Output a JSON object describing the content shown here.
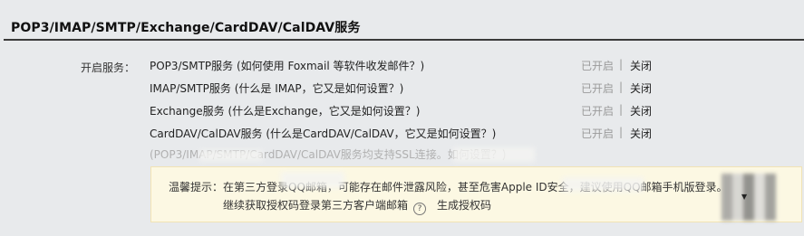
{
  "section": {
    "title": "POP3/IMAP/SMTP/Exchange/CardDAV/CalDAV服务"
  },
  "services": {
    "label": "开启服务：",
    "rows": [
      {
        "name": "POP3/SMTP服务 (如何使用 Foxmail 等软件收发邮件？)",
        "status": "已开启",
        "sep": "|",
        "action": "关闭"
      },
      {
        "name": "IMAP/SMTP服务 (什么是 IMAP，它又是如何设置？)",
        "status": "已开启",
        "sep": "|",
        "action": "关闭"
      },
      {
        "name": "Exchange服务 (什么是Exchange，它又是如何设置？)",
        "status": "已开启",
        "sep": "|",
        "action": "关闭"
      },
      {
        "name": "CardDAV/CalDAV服务 (什么是CardDAV/CalDAV，它又是如何设置？)",
        "status": "已开启",
        "sep": "|",
        "action": "关闭"
      }
    ],
    "ssl_note": "(POP3/IMAP/SMTP/CardDAV/CalDAV服务均支持SSL连接。如何设置？)"
  },
  "tip": {
    "line1": "温馨提示：在第三方登录QQ邮箱，可能存在邮件泄露风险，甚至危害Apple ID安全，建议使用QQ邮箱手机版登录。",
    "line2": "继续获取授权码登录第三方客户端邮箱",
    "help_icon": "question-circle-icon",
    "generate_label": "生成授权码"
  }
}
